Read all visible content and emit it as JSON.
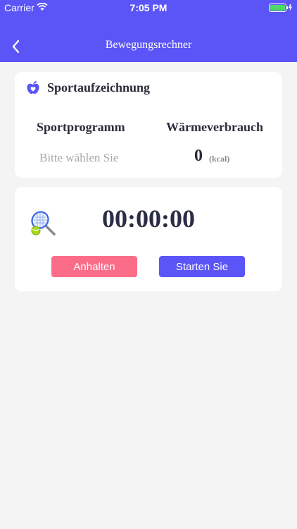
{
  "status_bar": {
    "carrier": "Carrier",
    "time": "7:05 PM"
  },
  "nav": {
    "title": "Bewegungsrechner"
  },
  "record": {
    "title": "Sportaufzeichnung",
    "program_label": "Sportprogramm",
    "energy_label": "Wärmeverbrauch",
    "program_placeholder": "Bitte wählen Sie",
    "energy_value": "0",
    "energy_unit": "(kcal)"
  },
  "timer": {
    "display": "00:00:00",
    "stop_label": "Anhalten",
    "start_label": "Starten Sie"
  },
  "colors": {
    "accent": "#5b55f7",
    "stop": "#fb6c89",
    "background": "#f4f4f4"
  }
}
